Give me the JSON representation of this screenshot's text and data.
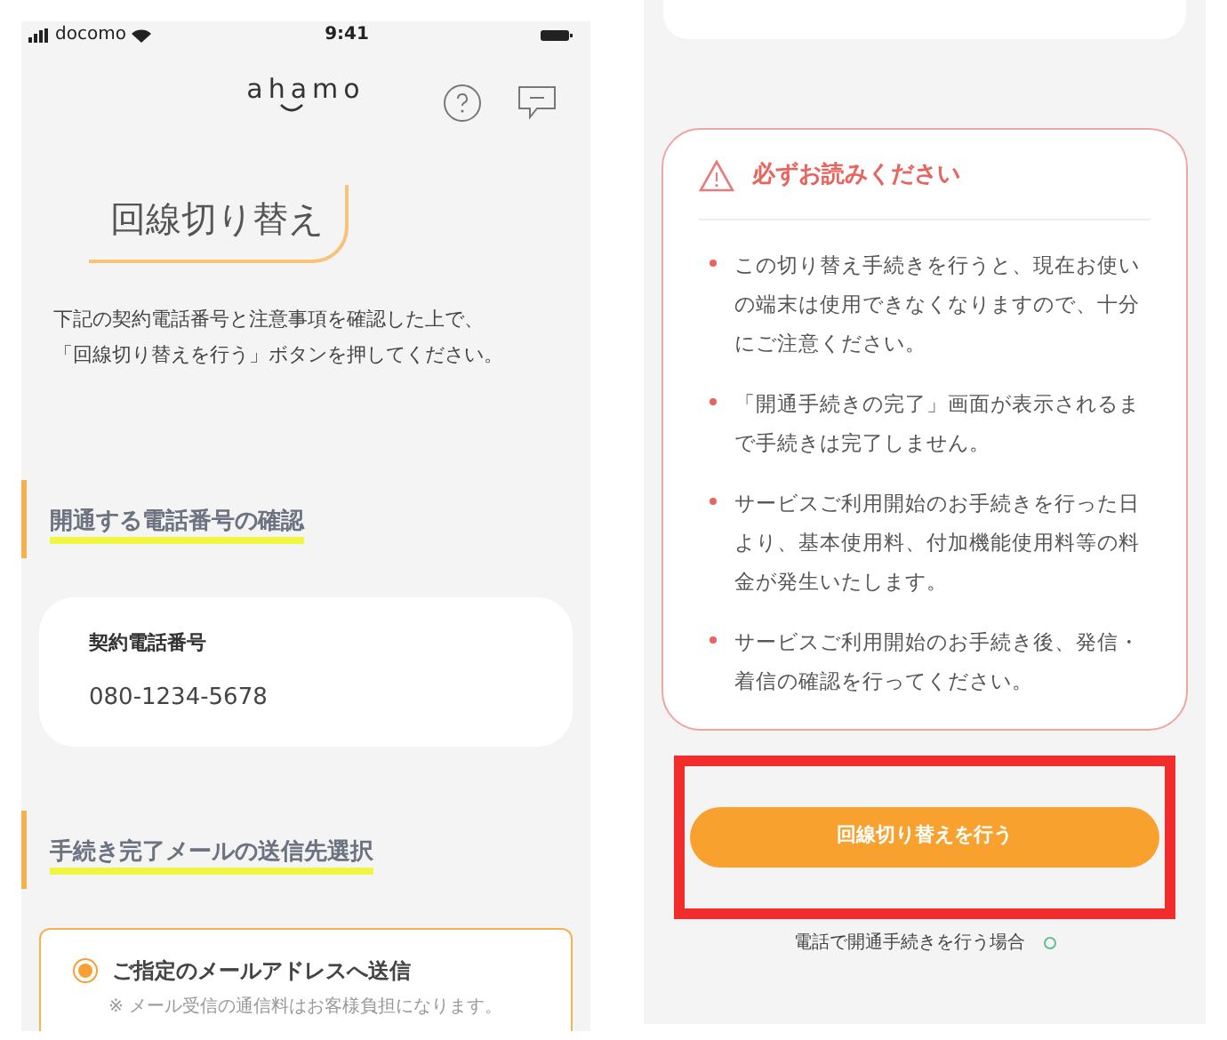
{
  "left_screen": {
    "status_bar": {
      "carrier": "docomo",
      "time": "9:41"
    },
    "header": {
      "logo": "ahamo"
    },
    "page_title": "回線切り替え",
    "description": [
      "下記の契約電話番号と注意事項を確認した上で、",
      "「回線切り替えを行う」ボタンを押してください。"
    ],
    "sections": [
      {
        "heading": "開通する電話番号の確認",
        "kind": "info",
        "label": "契約電話番号",
        "value": "080-1234-5678"
      },
      {
        "heading": "手続き完了メールの送信先選択",
        "kind": "choice",
        "options": [
          {
            "label": "ご指定のメールアドレスへ送信",
            "note": "※ メール受信の通信料はお客様負担になります。",
            "selected": true
          }
        ]
      }
    ]
  },
  "right_screen": {
    "notice": {
      "title": "必ずお読みください",
      "items": [
        "この切り替え手続きを行うと、現在お使いの端末は使用できなくなりますので、十分にご注意ください。",
        "「開通手続きの完了」画面が表示されるまで手続きは完了しません。",
        "サービスご利用開始のお手続きを行った日より、基本使用料、付加機能使用料等の料金が発生いたします。",
        "サービスご利用開始のお手続き後、発信・着信の確認を行ってください。"
      ]
    },
    "primary_button": "回線切り替えを行う",
    "phone_link": "電話で開通手続きを行う場合"
  }
}
